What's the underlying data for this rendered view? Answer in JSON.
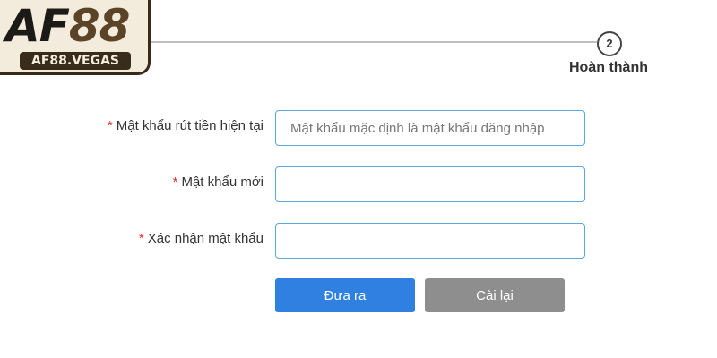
{
  "logo": {
    "main_prefix": "AF",
    "main_suffix": "88",
    "sub": "AF88.VEGAS"
  },
  "steps": {
    "current_number": "2",
    "current_label": "Hoàn thành"
  },
  "form": {
    "required_mark": "*",
    "fields": [
      {
        "label": "Mật khẩu rút tiền hiện tại",
        "value": "",
        "placeholder": "Mật khẩu mặc định là mật khẩu đăng nhập"
      },
      {
        "label": "Mật khẩu mới",
        "value": "",
        "placeholder": ""
      },
      {
        "label": "Xác nhận mật khẩu",
        "value": "",
        "placeholder": ""
      }
    ],
    "submit_label": "Đưa ra",
    "reset_label": "Cài lại"
  },
  "colors": {
    "accent": "#2f80e0",
    "reset": "#8e8e8e",
    "input_border": "#5aa8dc",
    "required": "#d33333"
  },
  "icons": {
    "logo": "af88-logo"
  }
}
